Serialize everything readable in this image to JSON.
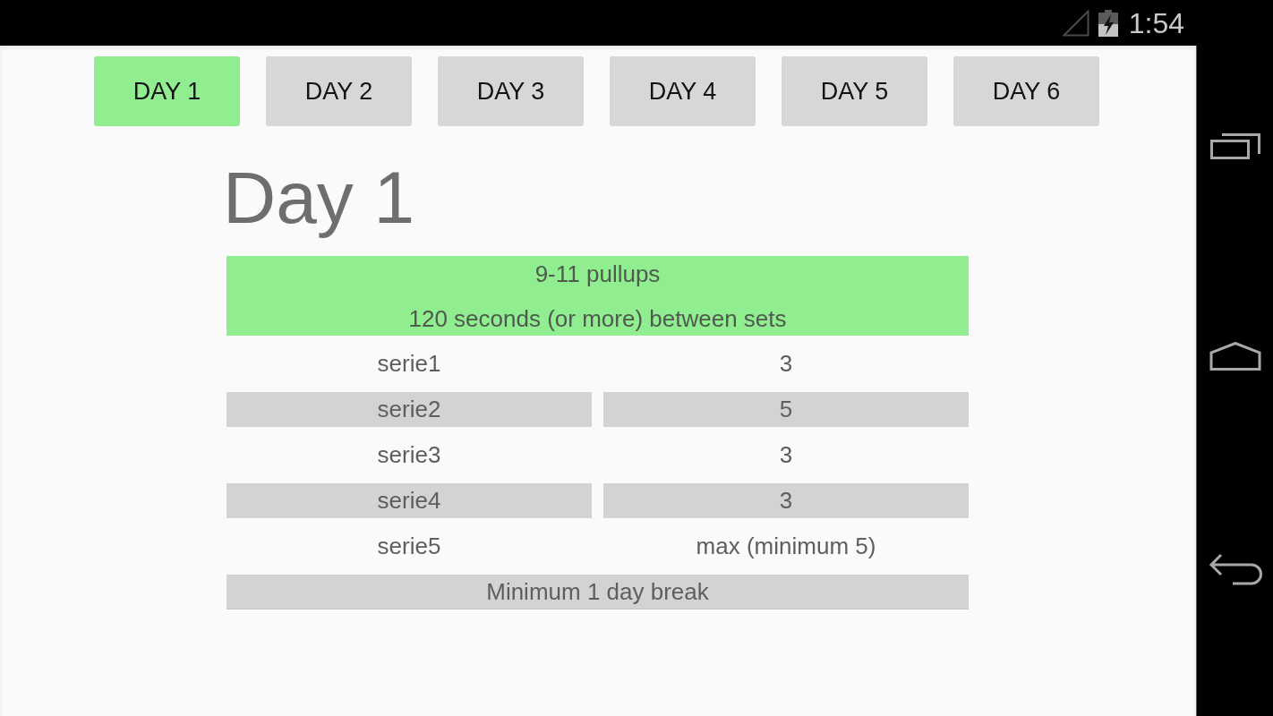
{
  "status_bar": {
    "time": "1:54"
  },
  "tabs": [
    {
      "label": "DAY 1",
      "selected": true
    },
    {
      "label": "DAY 2",
      "selected": false
    },
    {
      "label": "DAY 3",
      "selected": false
    },
    {
      "label": "DAY 4",
      "selected": false
    },
    {
      "label": "DAY 5",
      "selected": false
    },
    {
      "label": "DAY 6",
      "selected": false
    }
  ],
  "title": "Day 1",
  "table": {
    "header_lines": [
      "9-11 pullups",
      "120 seconds (or more) between sets"
    ],
    "rows": [
      {
        "series": "serie1",
        "reps": "3"
      },
      {
        "series": "serie2",
        "reps": "5"
      },
      {
        "series": "serie3",
        "reps": "3"
      },
      {
        "series": "serie4",
        "reps": "3"
      },
      {
        "series": "serie5",
        "reps": "max (minimum 5)"
      }
    ],
    "footer": "Minimum 1 day break"
  }
}
